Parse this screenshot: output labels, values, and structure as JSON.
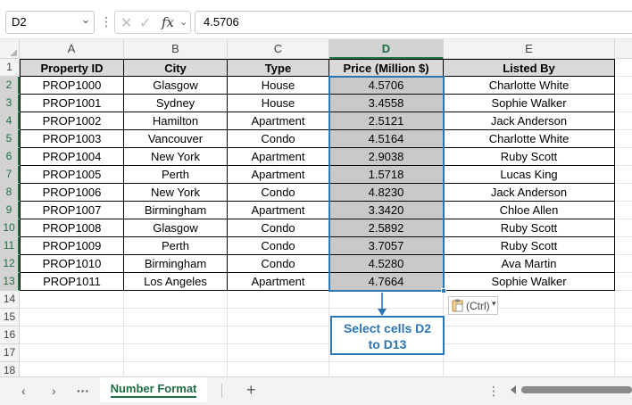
{
  "formula_bar": {
    "name_box": "D2",
    "menu_glyph": "⋮",
    "cancel_glyph": "✕",
    "enter_glyph": "✓",
    "fx_label": "fx",
    "formula_value": "4.5706"
  },
  "columns": [
    "A",
    "B",
    "C",
    "D",
    "E"
  ],
  "selected_column": "D",
  "row_numbers": [
    "1",
    "2",
    "3",
    "4",
    "5",
    "6",
    "7",
    "8",
    "9",
    "10",
    "11",
    "12",
    "13",
    "14",
    "15",
    "16",
    "17",
    "18"
  ],
  "table": {
    "headers": [
      "Property ID",
      "City",
      "Type",
      "Price (Million $)",
      "Listed By"
    ],
    "rows": [
      [
        "PROP1000",
        "Glasgow",
        "House",
        "4.5706",
        "Charlotte White"
      ],
      [
        "PROP1001",
        "Sydney",
        "House",
        "3.4558",
        "Sophie Walker"
      ],
      [
        "PROP1002",
        "Hamilton",
        "Apartment",
        "2.5121",
        "Jack Anderson"
      ],
      [
        "PROP1003",
        "Vancouver",
        "Condo",
        "4.5164",
        "Charlotte White"
      ],
      [
        "PROP1004",
        "New York",
        "Apartment",
        "2.9038",
        "Ruby Scott"
      ],
      [
        "PROP1005",
        "Perth",
        "Apartment",
        "1.5718",
        "Lucas King"
      ],
      [
        "PROP1006",
        "New York",
        "Condo",
        "4.8230",
        "Jack Anderson"
      ],
      [
        "PROP1007",
        "Birmingham",
        "Apartment",
        "3.3420",
        "Chloe Allen"
      ],
      [
        "PROP1008",
        "Glasgow",
        "Condo",
        "2.5892",
        "Ruby Scott"
      ],
      [
        "PROP1009",
        "Perth",
        "Condo",
        "3.7057",
        "Ruby Scott"
      ],
      [
        "PROP1010",
        "Birmingham",
        "Condo",
        "4.5280",
        "Ava Martin"
      ],
      [
        "PROP1011",
        "Los Angeles",
        "Apartment",
        "4.7664",
        "Sophie Walker"
      ]
    ]
  },
  "paste_options": {
    "label": "(Ctrl)",
    "caret": "▾"
  },
  "callout": {
    "line1": "Select cells D2",
    "line2": "to D13"
  },
  "sheet_tabs": {
    "prev": "‹",
    "next": "›",
    "more": "···",
    "active": "Number Format",
    "add": "+",
    "scroll_menu": "⋮"
  },
  "colors": {
    "accent": "#1e7145",
    "callout": "#2e75b6",
    "header_fill": "#d9d9d9",
    "selection_fill": "#c9c9c9"
  }
}
